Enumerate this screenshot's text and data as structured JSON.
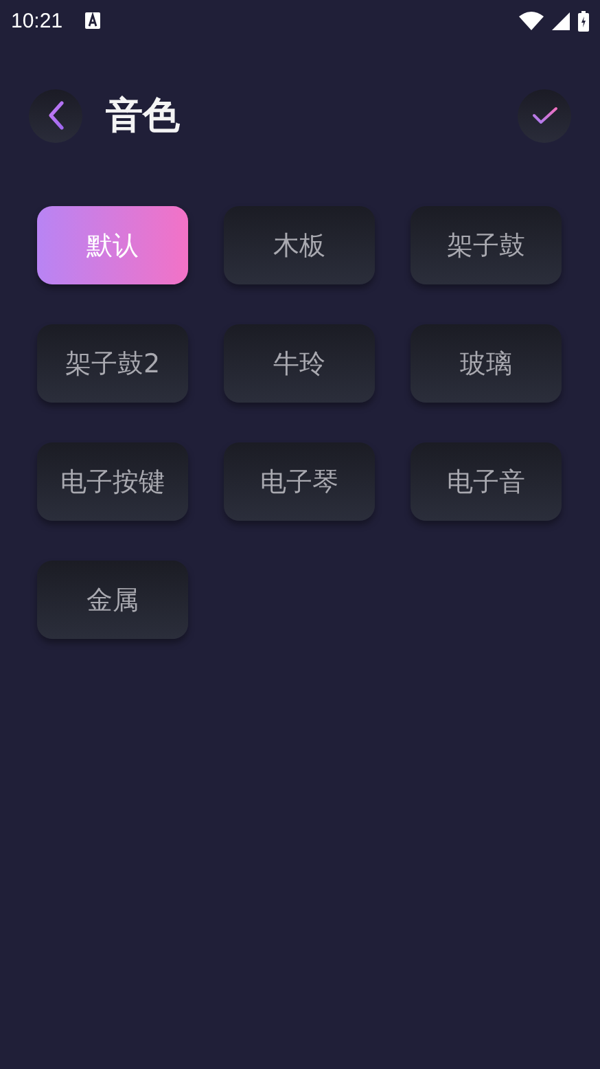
{
  "status_bar": {
    "time": "10:21"
  },
  "header": {
    "title": "音色"
  },
  "tones": [
    {
      "label": "默认",
      "selected": true
    },
    {
      "label": "木板",
      "selected": false
    },
    {
      "label": "架子鼓",
      "selected": false
    },
    {
      "label": "架子鼓2",
      "selected": false
    },
    {
      "label": "牛玲",
      "selected": false
    },
    {
      "label": "玻璃",
      "selected": false
    },
    {
      "label": "电子按键",
      "selected": false
    },
    {
      "label": "电子琴",
      "selected": false
    },
    {
      "label": "电子音",
      "selected": false
    },
    {
      "label": "金属",
      "selected": false
    }
  ]
}
